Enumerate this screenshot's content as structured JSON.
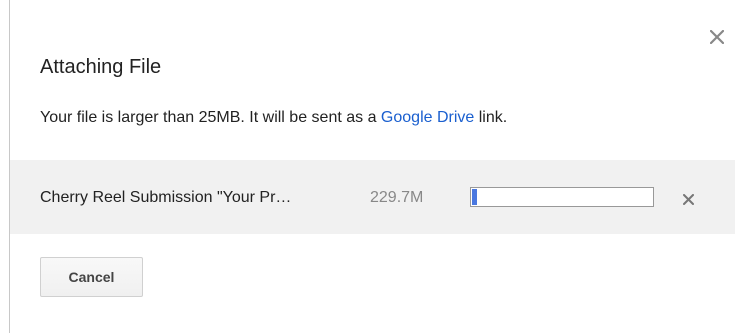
{
  "dialog": {
    "title": "Attaching File",
    "message_prefix": "Your file is larger than 25MB. It will be sent as a ",
    "message_link": "Google Drive",
    "message_suffix": " link.",
    "close_icon": "close-icon"
  },
  "file": {
    "name": "Cherry Reel Submission \"Your Pr…",
    "size": "229.7M",
    "progress_fraction": 0.03,
    "remove_icon": "close-icon"
  },
  "actions": {
    "cancel_label": "Cancel"
  },
  "colors": {
    "link": "#1a5fcf",
    "progress_fill": "#4a78e0",
    "file_row_bg": "#f1f1f1"
  }
}
